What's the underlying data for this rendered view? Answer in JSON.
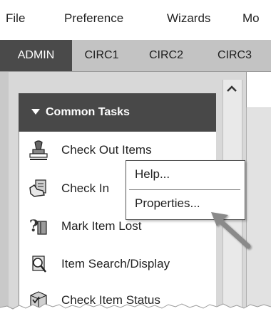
{
  "menubar": {
    "items": [
      "File",
      "Preference",
      "Wizards",
      "Mo"
    ]
  },
  "tabs": [
    {
      "label": "ADMIN",
      "active": true
    },
    {
      "label": "CIRC1",
      "active": false
    },
    {
      "label": "CIRC2",
      "active": false
    },
    {
      "label": "CIRC3",
      "active": false
    }
  ],
  "panel": {
    "title": "Common Tasks"
  },
  "tasks": [
    {
      "label": "Check Out Items",
      "icon": "stamp-icon"
    },
    {
      "label": "Check In",
      "icon": "hand-book-icon"
    },
    {
      "label": "Mark Item Lost",
      "icon": "question-book-icon"
    },
    {
      "label": "Item Search/Display",
      "icon": "search-book-icon"
    },
    {
      "label": "Check Item Status",
      "icon": "status-box-icon"
    }
  ],
  "context_menu": {
    "items": [
      "Help...",
      "Properties..."
    ]
  },
  "colors": {
    "active_tab": "#4a4a4a",
    "tab_bar": "#c3c3c3",
    "panel_header": "#484848"
  }
}
